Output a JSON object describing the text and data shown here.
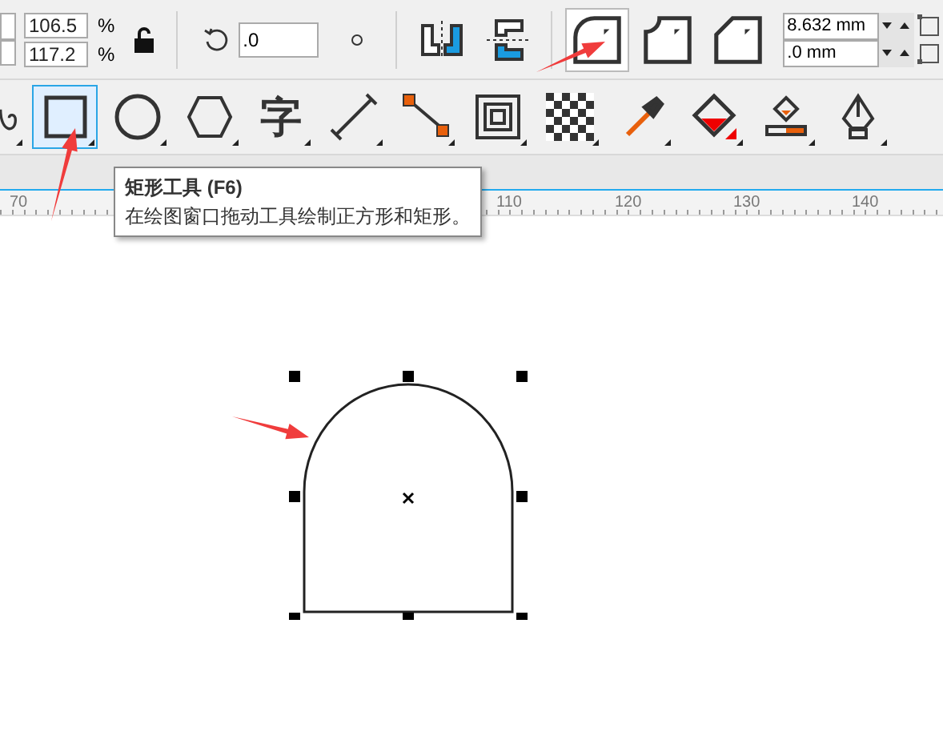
{
  "property_bar": {
    "scale": [
      {
        "value": "106.5",
        "unit": "%"
      },
      {
        "value": "117.2",
        "unit": "%"
      }
    ],
    "rotation": ".0",
    "corner_buttons": [
      {
        "kind": "round",
        "selected": true
      },
      {
        "kind": "scallop",
        "selected": false
      },
      {
        "kind": "chamfer",
        "selected": false
      }
    ],
    "corner_sizes": [
      "8.632 mm",
      ".0 mm"
    ]
  },
  "toolbox": [
    {
      "kind": "spiral",
      "selected": false
    },
    {
      "kind": "rectangle",
      "selected": true
    },
    {
      "kind": "ellipse",
      "selected": false
    },
    {
      "kind": "polygon",
      "selected": false
    },
    {
      "kind": "text",
      "glyph": "字",
      "selected": false
    },
    {
      "kind": "dimension",
      "selected": false
    },
    {
      "kind": "connector",
      "selected": false
    },
    {
      "kind": "contour",
      "selected": false
    },
    {
      "kind": "transparency",
      "selected": false
    },
    {
      "kind": "eyedropper",
      "selected": false
    },
    {
      "kind": "fill",
      "selected": false
    },
    {
      "kind": "smartfill",
      "selected": false
    },
    {
      "kind": "pen",
      "selected": false
    }
  ],
  "tooltip": {
    "title": "矩形工具 (F6)",
    "description": "在绘图窗口拖动工具绘制正方形和矩形。"
  },
  "ruler": [
    "70",
    "110",
    "120",
    "130",
    "140"
  ]
}
